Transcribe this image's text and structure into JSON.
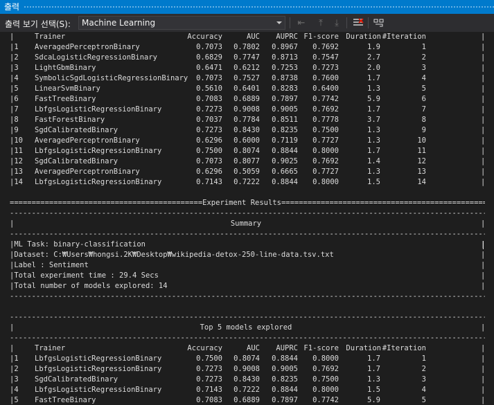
{
  "window": {
    "title": "출력"
  },
  "toolbar": {
    "show_output_label": "출력 보기 선택(S):",
    "selected_source": "Machine Learning",
    "buttons": [
      "find-message-icon",
      "prev-message-icon",
      "next-message-icon",
      "clear-all-icon",
      "word-wrap-icon"
    ]
  },
  "results_table": {
    "headers": [
      "Trainer",
      "Accuracy",
      "AUC",
      "AUPRC",
      "F1-score",
      "Duration",
      "#Iteration"
    ],
    "rows": [
      [
        "1",
        "AveragedPerceptronBinary",
        "0.7073",
        "0.7802",
        "0.8967",
        "0.7692",
        "1.9",
        "1"
      ],
      [
        "2",
        "SdcaLogisticRegressionBinary",
        "0.6829",
        "0.7747",
        "0.8713",
        "0.7547",
        "2.7",
        "2"
      ],
      [
        "3",
        "LightGbmBinary",
        "0.6471",
        "0.6212",
        "0.7253",
        "0.7273",
        "2.0",
        "3"
      ],
      [
        "4",
        "SymbolicSgdLogisticRegressionBinary",
        "0.7073",
        "0.7527",
        "0.8738",
        "0.7600",
        "1.7",
        "4"
      ],
      [
        "5",
        "LinearSvmBinary",
        "0.5610",
        "0.6401",
        "0.8283",
        "0.6400",
        "1.3",
        "5"
      ],
      [
        "6",
        "FastTreeBinary",
        "0.7083",
        "0.6889",
        "0.7897",
        "0.7742",
        "5.9",
        "6"
      ],
      [
        "7",
        "LbfgsLogisticRegressionBinary",
        "0.7273",
        "0.9008",
        "0.9005",
        "0.7692",
        "1.7",
        "7"
      ],
      [
        "8",
        "FastForestBinary",
        "0.7037",
        "0.7784",
        "0.8511",
        "0.7778",
        "3.7",
        "8"
      ],
      [
        "9",
        "SgdCalibratedBinary",
        "0.7273",
        "0.8430",
        "0.8235",
        "0.7500",
        "1.3",
        "9"
      ],
      [
        "10",
        "AveragedPerceptronBinary",
        "0.6296",
        "0.6000",
        "0.7119",
        "0.7727",
        "1.3",
        "10"
      ],
      [
        "11",
        "LbfgsLogisticRegressionBinary",
        "0.7500",
        "0.8074",
        "0.8844",
        "0.8000",
        "1.7",
        "11"
      ],
      [
        "12",
        "SgdCalibratedBinary",
        "0.7073",
        "0.8077",
        "0.9025",
        "0.7692",
        "1.4",
        "12"
      ],
      [
        "13",
        "AveragedPerceptronBinary",
        "0.6296",
        "0.5059",
        "0.6665",
        "0.7727",
        "1.3",
        "13"
      ],
      [
        "14",
        "LbfgsLogisticRegressionBinary",
        "0.7143",
        "0.7222",
        "0.8844",
        "0.8000",
        "1.5",
        "14"
      ]
    ]
  },
  "experiment": {
    "banner": "Experiment Results",
    "summary_title": "Summary",
    "lines": [
      "ML Task: binary-classification",
      "Dataset: C:₩Users₩hongsi.2K₩Desktop₩wikipedia-detox-250-line-data.tsv.txt",
      "Label : Sentiment",
      "Total experiment time : 29.4 Secs",
      "Total number of models explored: 14"
    ]
  },
  "top_models": {
    "title": "Top 5 models explored",
    "headers": [
      "Trainer",
      "Accuracy",
      "AUC",
      "AUPRC",
      "F1-score",
      "Duration",
      "#Iteration"
    ],
    "rows": [
      [
        "1",
        "LbfgsLogisticRegressionBinary",
        "0.7500",
        "0.8074",
        "0.8844",
        "0.8000",
        "1.7",
        "1"
      ],
      [
        "2",
        "LbfgsLogisticRegressionBinary",
        "0.7273",
        "0.9008",
        "0.9005",
        "0.7692",
        "1.7",
        "2"
      ],
      [
        "3",
        "SgdCalibratedBinary",
        "0.7273",
        "0.8430",
        "0.8235",
        "0.7500",
        "1.3",
        "3"
      ],
      [
        "4",
        "LbfgsLogisticRegressionBinary",
        "0.7143",
        "0.7222",
        "0.8844",
        "0.8000",
        "1.5",
        "4"
      ],
      [
        "5",
        "FastTreeBinary",
        "0.7083",
        "0.6889",
        "0.7897",
        "0.7742",
        "5.9",
        "5"
      ]
    ]
  },
  "colors": {
    "accent": "#007acc",
    "background": "#1e1e1e",
    "toolbar": "#2d2d30",
    "text": "#dcdcdc"
  }
}
